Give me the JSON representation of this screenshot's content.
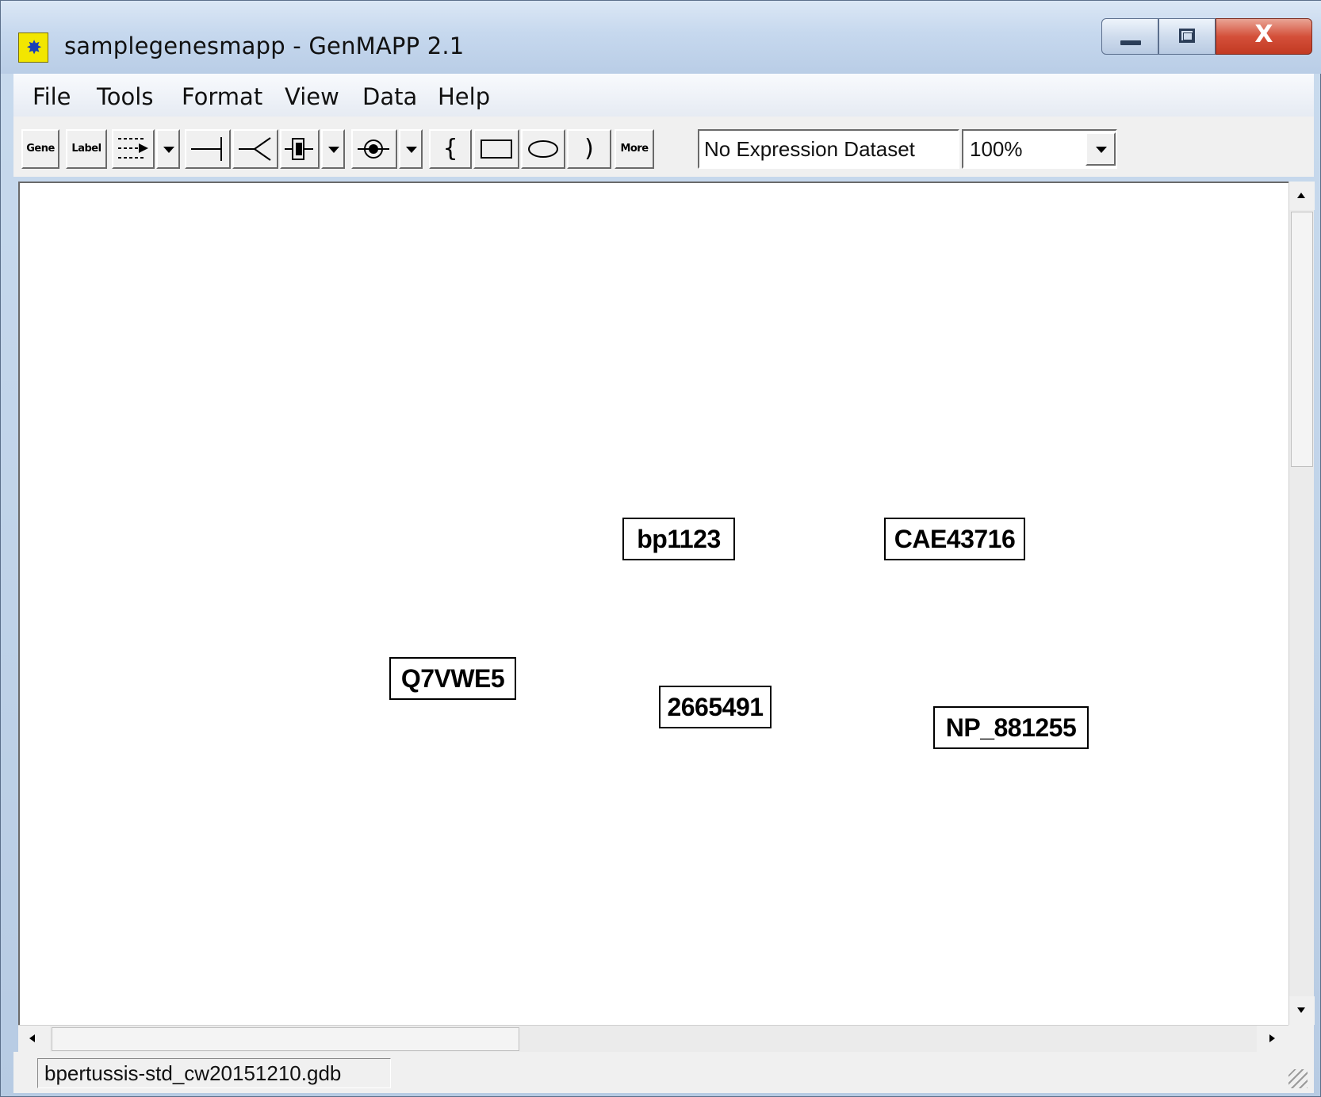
{
  "window": {
    "title": "samplegenesmapp - GenMAPP 2.1",
    "app_icon": "genmapp-logo-icon",
    "controls": {
      "minimize": "minimize-icon",
      "maximize": "maximize-icon",
      "close_label": "X"
    }
  },
  "menubar": {
    "items": [
      "File",
      "Tools",
      "Format",
      "View",
      "Data",
      "Help"
    ]
  },
  "toolbar": {
    "gene_label": "Gene",
    "label_label": "Label",
    "brace_left": "{",
    "brace_right": ")",
    "more_label": "More",
    "line_icon": "—|",
    "receptor_icon": "—<",
    "expression_dataset": "No Expression Dataset",
    "zoom": "100%"
  },
  "canvas": {
    "genes": [
      "bp1123",
      "CAE43716",
      "Q7VWE5",
      "2665491",
      "NP_881255"
    ]
  },
  "statusbar": {
    "database": "bpertussis-std_cw20151210.gdb"
  },
  "colors": {
    "titlebar": "#c6d8ee",
    "close_button": "#c23a22",
    "canvas": "#ffffff",
    "toolbar": "#f0f0f0"
  }
}
